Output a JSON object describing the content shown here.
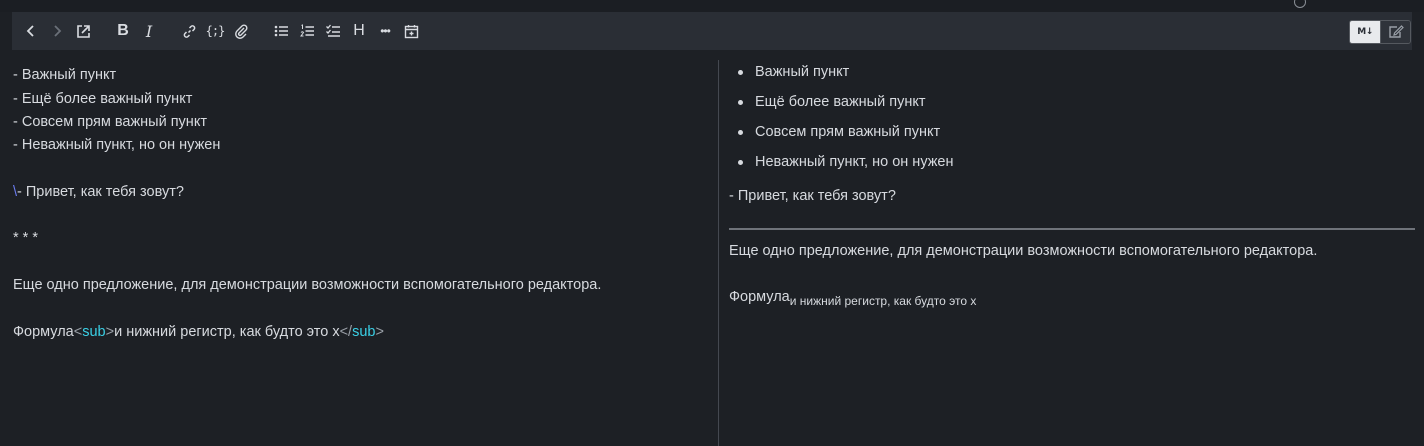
{
  "toolbar": {
    "buttons": [
      {
        "name": "back",
        "icon": "chevron-left-icon"
      },
      {
        "name": "forward",
        "icon": "chevron-right-icon"
      },
      {
        "name": "open-external",
        "icon": "external-link-icon"
      },
      {
        "name": "bold",
        "icon": "bold-icon",
        "label": "B"
      },
      {
        "name": "italic",
        "icon": "italic-icon",
        "label": "I"
      },
      {
        "name": "link",
        "icon": "link-icon"
      },
      {
        "name": "code",
        "icon": "code-braces-icon",
        "label": "{;}"
      },
      {
        "name": "attach",
        "icon": "paperclip-icon"
      },
      {
        "name": "bullet-list",
        "icon": "bullet-list-icon"
      },
      {
        "name": "numbered-list",
        "icon": "numbered-list-icon"
      },
      {
        "name": "check-list",
        "icon": "checklist-icon"
      },
      {
        "name": "heading",
        "icon": "heading-icon",
        "label": "H"
      },
      {
        "name": "more",
        "icon": "more-icon",
        "label": "•••"
      },
      {
        "name": "insert-table",
        "icon": "calendar-plus-icon"
      }
    ],
    "mode": {
      "markdown_label": "M↓",
      "active": "markdown"
    }
  },
  "editor": {
    "lines": [
      "- Важный пункт",
      "- Ещё более важный пункт",
      "- Совсем прям важный пункт",
      "- Неважный пункт, но он нужен",
      "",
      "\\- Привет, как тебя зовут?",
      "",
      "* * *",
      "",
      "Еще одно предложение, для демонстрации возможности вспомогательного редактора.",
      "",
      "Формула<sub>и нижний регистр, как будто это x</sub>"
    ],
    "escape_char": "\\",
    "escaped_rest": "- Привет, как тебя зовут?",
    "formula_prefix": "Формула",
    "sub_tag_open": "sub",
    "sub_text": "и нижний регистр, как будто это x",
    "sub_tag_close": "sub"
  },
  "preview": {
    "list_items": [
      "Важный пункт",
      "Ещё более важный пункт",
      "Совсем прям важный пункт",
      "Неважный пункт, но он нужен"
    ],
    "escaped_line": "- Привет, как тебя зовут?",
    "paragraph": "Еще одно предложение, для демонстрации возможности вспомогательного редактора.",
    "formula_text": "Формула",
    "formula_sub": "и нижний регистр, как будто это x"
  },
  "colors": {
    "background": "#1d2025",
    "toolbar": "#2a2e35",
    "text": "#d7dadf",
    "tag": "#3ad0e6",
    "escape": "#6b7cf0"
  }
}
